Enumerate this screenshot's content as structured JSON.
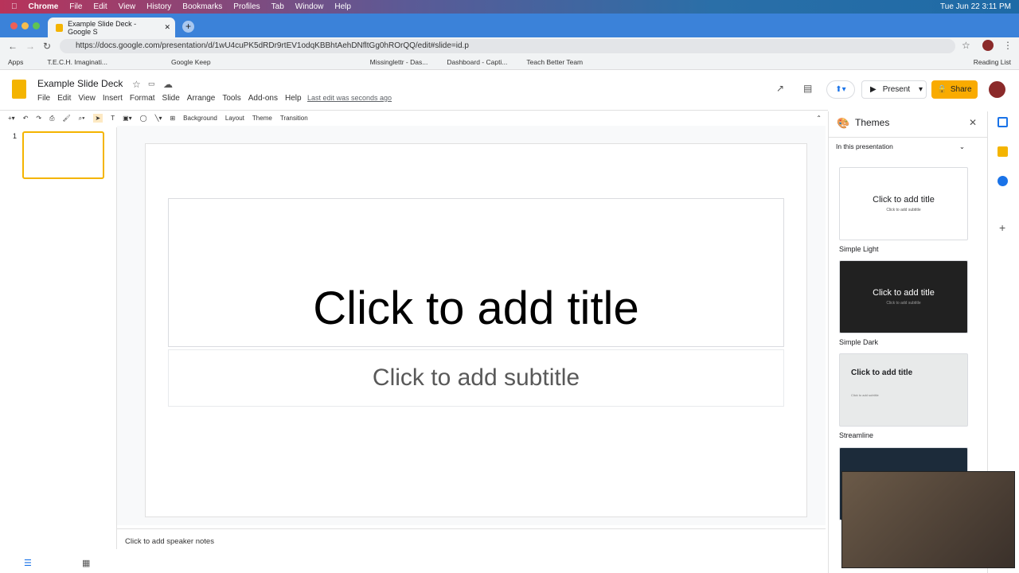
{
  "mac_menu": {
    "app": "Chrome",
    "items": [
      "File",
      "Edit",
      "View",
      "History",
      "Bookmarks",
      "Profiles",
      "Tab",
      "Window",
      "Help"
    ],
    "clock": "Tue Jun 22  3:11 PM"
  },
  "browser": {
    "tab_title": "Example Slide Deck - Google S",
    "url": "https://docs.google.com/presentation/d/1wU4cuPK5dRDr9rtEV1odqKBBhtAehDNfltGg0hROrQQ/edit#slide=id.p",
    "bookmarks": [
      "Apps",
      "T.E.C.H. Imaginati...",
      "Google Keep",
      "Missinglettr - Das...",
      "Dashboard - Capti...",
      "Teach Better Team"
    ],
    "reading_list": "Reading List"
  },
  "doc": {
    "title": "Example Slide Deck",
    "menu": [
      "File",
      "Edit",
      "View",
      "Insert",
      "Format",
      "Slide",
      "Arrange",
      "Tools",
      "Add-ons",
      "Help"
    ],
    "last_edit": "Last edit was seconds ago",
    "present": "Present",
    "share": "Share"
  },
  "toolbar": {
    "background": "Background",
    "layout": "Layout",
    "theme": "Theme",
    "transition": "Transition"
  },
  "filmstrip": {
    "slide_number": "1"
  },
  "slide": {
    "title_placeholder": "Click to add title",
    "subtitle_placeholder": "Click to add subtitle"
  },
  "notes": {
    "placeholder": "Click to add speaker notes"
  },
  "themes": {
    "header": "Themes",
    "filter": "In this presentation",
    "items": [
      {
        "name": "Simple Light",
        "title": "Click to add title",
        "subtitle": "Click to add subtitle"
      },
      {
        "name": "Simple Dark",
        "title": "Click to add title",
        "subtitle": "Click to add subtitle"
      },
      {
        "name": "Streamline",
        "title": "Click to add title",
        "subtitle": "Click to add subtitle"
      }
    ]
  },
  "colors": {
    "accent": "#f9ab00",
    "chrome_tab": "#3b82d9"
  }
}
